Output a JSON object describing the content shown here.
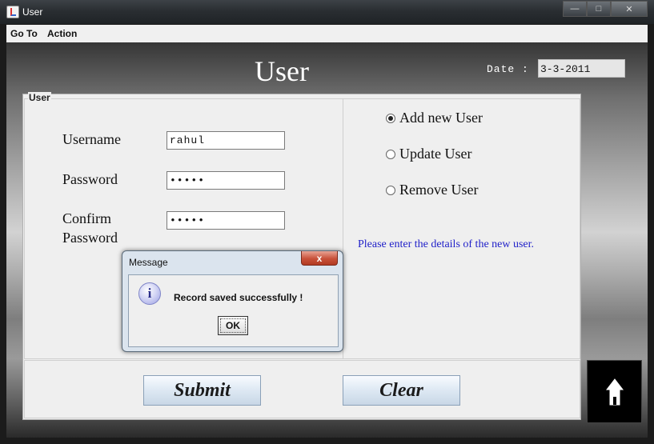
{
  "window": {
    "title": "User",
    "min_icon": "minimize-icon",
    "max_icon": "maximize-icon",
    "close_icon": "close-icon"
  },
  "menu": [
    {
      "label": "Go To"
    },
    {
      "label": "Action"
    }
  ],
  "header": {
    "title": "User",
    "date_label": "Date :",
    "date_value": "3-3-2011"
  },
  "panel": {
    "legend": "User"
  },
  "form": {
    "username_label": "Username",
    "username_value": "rahul",
    "password_label": "Password",
    "password_value": "•••••",
    "confirm_label_line1": "Confirm",
    "confirm_label_line2": "Password",
    "confirm_value": "•••••"
  },
  "options": [
    {
      "label": "Add new User",
      "checked": true
    },
    {
      "label": "Update User",
      "checked": false
    },
    {
      "label": "Remove User",
      "checked": false
    }
  ],
  "hint": "Please enter the details of the new user.",
  "buttons": {
    "submit": "Submit",
    "clear": "Clear"
  },
  "home": {
    "icon": "home-icon"
  },
  "dialog": {
    "title": "Message",
    "close_glyph": "x",
    "icon": "info-icon",
    "icon_glyph": "i",
    "message": "Record saved successfully !",
    "ok": "OK"
  }
}
